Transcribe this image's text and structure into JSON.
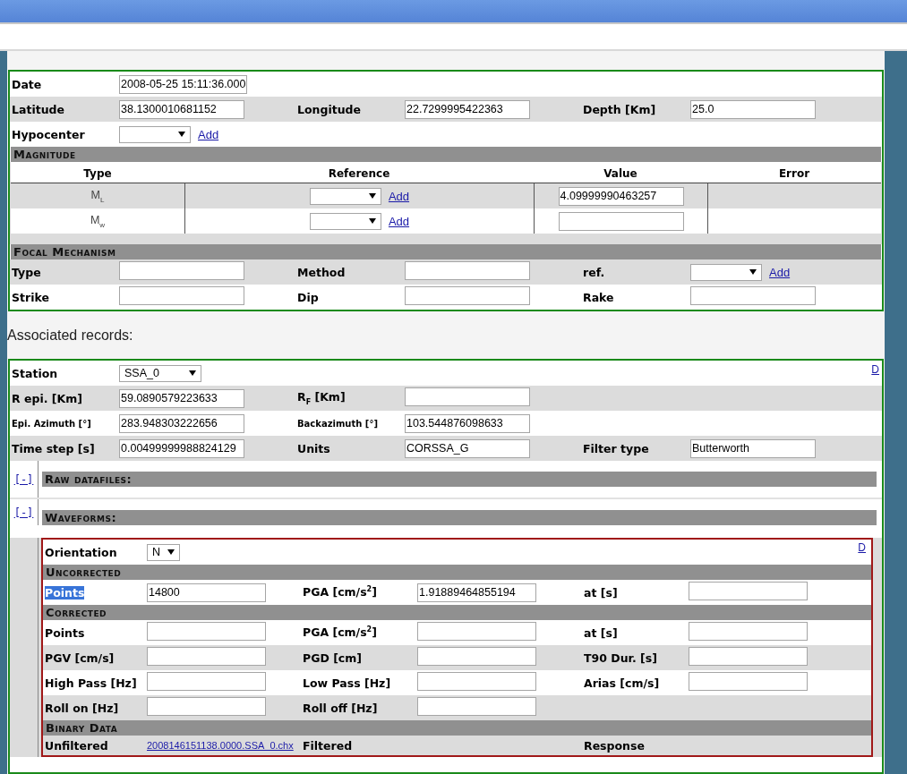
{
  "event": {
    "basic_rows": [
      {
        "shaded": false,
        "cells": [
          {
            "label": "Date",
            "field": {
              "kind": "input",
              "value": "2008-05-25 15:11:36.000"
            }
          }
        ]
      },
      {
        "shaded": true,
        "cells": [
          {
            "label": "Latitude",
            "field": {
              "kind": "input",
              "value": "38.1300010681152"
            }
          },
          {
            "label": "Longitude",
            "field": {
              "kind": "input",
              "value": "22.7299995422363"
            }
          },
          {
            "label": "Depth [Km]",
            "field": {
              "kind": "input",
              "value": "25.0"
            }
          }
        ]
      },
      {
        "shaded": false,
        "cells": [
          {
            "label": "Hypocenter",
            "field": {
              "kind": "select",
              "add": "Add"
            }
          }
        ]
      }
    ],
    "magnitude": {
      "title": "Magnitude",
      "columns": [
        "Type",
        "Reference",
        "Value",
        "Error"
      ],
      "rows": [
        {
          "shaded": true,
          "type": "M$_{L}$",
          "reference": {
            "kind": "select",
            "add": "Add"
          },
          "value": {
            "kind": "input",
            "value": "4.09999990463257"
          }
        },
        {
          "shaded": false,
          "type": "M$_{w}$",
          "reference": {
            "kind": "select",
            "add": "Add"
          },
          "value": {
            "kind": "input"
          }
        }
      ]
    },
    "focal": {
      "title": "Focal Mechanism",
      "rows": [
        {
          "shaded": true,
          "cells": [
            {
              "label": "Type",
              "field": {
                "kind": "input"
              }
            },
            {
              "label": "Method",
              "field": {
                "kind": "input"
              }
            },
            {
              "label": "ref.",
              "field": {
                "kind": "select",
                "add": "Add"
              }
            }
          ]
        },
        {
          "shaded": false,
          "cells": [
            {
              "label": "Strike",
              "field": {
                "kind": "input"
              }
            },
            {
              "label": "Dip",
              "field": {
                "kind": "input"
              }
            },
            {
              "label": "Rake",
              "field": {
                "kind": "input"
              }
            }
          ]
        }
      ]
    }
  },
  "associated_title": "Associated records:",
  "record": {
    "d_link": "D",
    "rows": [
      {
        "shaded": false,
        "cells": [
          {
            "label": "Station",
            "field": {
              "kind": "select",
              "value": "SSA_0"
            }
          }
        ]
      },
      {
        "shaded": true,
        "cells": [
          {
            "label": "R epi. [Km]",
            "field": {
              "kind": "input",
              "value": "59.0890579223633"
            }
          },
          {
            "label": "R$_{F}$ [Km]",
            "field": {
              "kind": "input"
            }
          }
        ]
      },
      {
        "shaded": false,
        "small": true,
        "cells": [
          {
            "label": "Epi. Azimuth [°]",
            "field": {
              "kind": "input",
              "value": "283.948303222656"
            }
          },
          {
            "label": "Backazimuth [°]",
            "field": {
              "kind": "input",
              "value": "103.544876098633"
            }
          }
        ]
      },
      {
        "shaded": true,
        "cells": [
          {
            "label": "Time step [s]",
            "field": {
              "kind": "input",
              "value": "0.00499999988824129"
            }
          },
          {
            "label": "Units",
            "field": {
              "kind": "input",
              "value": "CORSSA_G"
            }
          },
          {
            "label": "Filter type",
            "field": {
              "kind": "input",
              "value": "Butterworth"
            }
          }
        ]
      }
    ],
    "sections": [
      {
        "toggle": "[-]",
        "title": "Raw datafiles:"
      },
      {
        "toggle": "[-]",
        "title": "Waveforms:",
        "waveform": {
          "d_link": "D",
          "rows": [
            {
              "shaded": false,
              "cells": [
                {
                  "label": "Orientation",
                  "field": {
                    "kind": "select",
                    "value": "N"
                  }
                }
              ]
            }
          ],
          "groups": [
            {
              "title": "Uncorrected",
              "rows": [
                {
                  "shaded": false,
                  "cells": [
                    {
                      "label": "Points",
                      "highlighted": true,
                      "field": {
                        "kind": "input",
                        "value": "14800"
                      }
                    },
                    {
                      "label": "PGA [cm/s$^{2}$]",
                      "field": {
                        "kind": "input",
                        "value": "1.91889464855194"
                      }
                    },
                    {
                      "label": "at [s]",
                      "field": {
                        "kind": "input"
                      }
                    }
                  ]
                }
              ]
            },
            {
              "title": "Corrected",
              "rows": [
                {
                  "shaded": false,
                  "cells": [
                    {
                      "label": "Points",
                      "field": {
                        "kind": "input"
                      }
                    },
                    {
                      "label": "PGA [cm/s$^{2}$]",
                      "field": {
                        "kind": "input"
                      }
                    },
                    {
                      "label": "at [s]",
                      "field": {
                        "kind": "input"
                      }
                    }
                  ]
                },
                {
                  "shaded": true,
                  "cells": [
                    {
                      "label": "PGV [cm/s]",
                      "field": {
                        "kind": "input"
                      }
                    },
                    {
                      "label": "PGD [cm]",
                      "field": {
                        "kind": "input"
                      }
                    },
                    {
                      "label": "T90 Dur. [s]",
                      "field": {
                        "kind": "input"
                      }
                    }
                  ]
                },
                {
                  "shaded": false,
                  "cells": [
                    {
                      "label": "High Pass [Hz]",
                      "field": {
                        "kind": "input"
                      }
                    },
                    {
                      "label": "Low Pass [Hz]",
                      "field": {
                        "kind": "input"
                      }
                    },
                    {
                      "label": "Arias [cm/s]",
                      "field": {
                        "kind": "input"
                      }
                    }
                  ]
                },
                {
                  "shaded": true,
                  "cells": [
                    {
                      "label": "Roll on [Hz]",
                      "field": {
                        "kind": "input"
                      }
                    },
                    {
                      "label": "Roll off [Hz]",
                      "field": {
                        "kind": "input"
                      }
                    }
                  ]
                }
              ]
            }
          ],
          "binary": {
            "title": "Binary Data",
            "shaded": true,
            "cells": [
              {
                "label": "Unfiltered",
                "link": "2008146151138.0000.SSA_0.chx"
              },
              {
                "label": "Filtered"
              },
              {
                "label": "Response"
              }
            ]
          }
        }
      }
    ]
  }
}
